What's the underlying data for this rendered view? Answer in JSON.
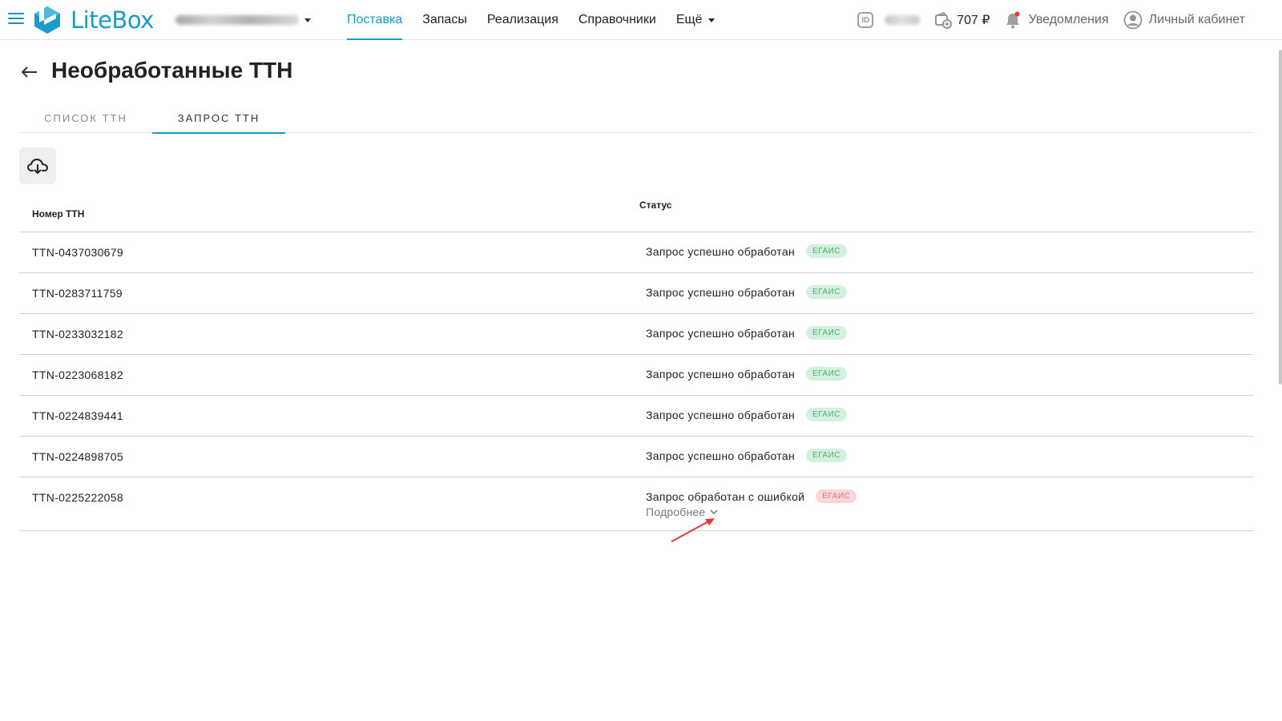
{
  "header": {
    "brand": "LiteBox",
    "nav": [
      {
        "label": "Поставка"
      },
      {
        "label": "Запасы"
      },
      {
        "label": "Реализация"
      },
      {
        "label": "Справочники"
      },
      {
        "label": "Ещё"
      }
    ],
    "id_label": "ID",
    "balance": "707 ₽",
    "notifications_label": "Уведомления",
    "account_label": "Личный кабинет"
  },
  "page": {
    "title": "Необработанные ТТН",
    "tabs": [
      {
        "label": "СПИСОК ТТН"
      },
      {
        "label": "ЗАПРОС ТТН"
      }
    ]
  },
  "table": {
    "columns": {
      "number": "Номер ТТН",
      "status": "Статус"
    },
    "rows": [
      {
        "number": "TTN-0437030679",
        "status": "Запрос успешно обработан",
        "badge": "ЕГАИС"
      },
      {
        "number": "TTN-0283711759",
        "status": "Запрос успешно обработан",
        "badge": "ЕГАИС"
      },
      {
        "number": "TTN-0233032182",
        "status": "Запрос успешно обработан",
        "badge": "ЕГАИС"
      },
      {
        "number": "TTN-0223068182",
        "status": "Запрос успешно обработан",
        "badge": "ЕГАИС"
      },
      {
        "number": "TTN-0224839441",
        "status": "Запрос успешно обработан",
        "badge": "ЕГАИС"
      },
      {
        "number": "TTN-0224898705",
        "status": "Запрос успешно обработан",
        "badge": "ЕГАИС"
      },
      {
        "number": "TTN-0225222058",
        "status": "Запрос обработан с ошибкой",
        "badge": "ЕГАИС",
        "more": "Подробнее"
      }
    ]
  },
  "colors": {
    "accent": "#1a9bc8",
    "success_badge_bg": "#d4f0de",
    "success_badge_text": "#4caf6e",
    "error_badge_bg": "#fad7d7",
    "error_badge_text": "#e57373",
    "annotation_arrow": "#e53935"
  }
}
